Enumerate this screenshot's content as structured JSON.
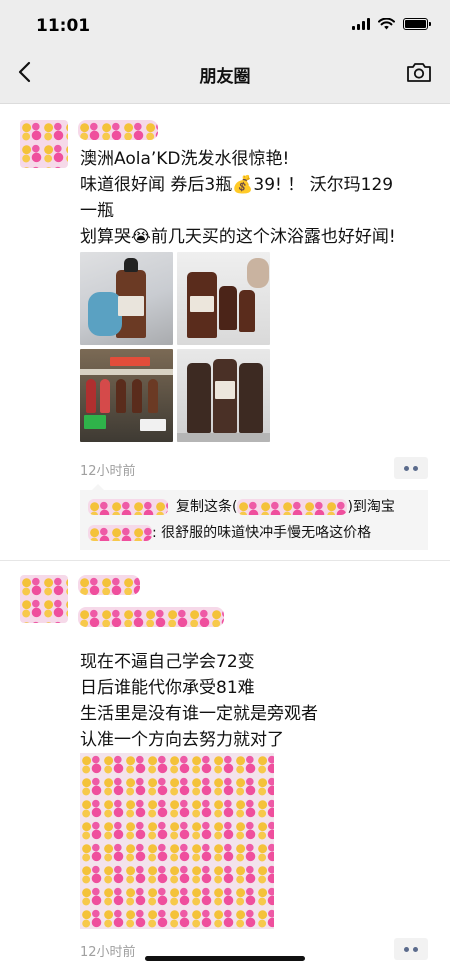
{
  "status_bar": {
    "time": "11:01"
  },
  "nav": {
    "title": "朋友圈"
  },
  "posts": [
    {
      "text": [
        "澳洲Aola’KD洗发水很惊艳!",
        "味道很好闻 券后3瓶💰39!  ！ 沃尔玛129",
        "一瓶",
        "划算哭😭前几天买的这个沐浴露也好好闻!"
      ],
      "photos": [
        "shampoo-hand-photo",
        "bottles-counter-photo",
        "store-shelf-photo",
        "bottles-display-photo"
      ],
      "timestamp": "12小时前",
      "comments": [
        {
          "pre": "复制这条(",
          "post": ")到淘宝"
        },
        {
          "pre": ": 很舒服的味道快冲手慢无咯这价格",
          "post": ""
        }
      ]
    },
    {
      "text": [
        "现在不逼自己学会72变",
        "日后谁能代你承受81难",
        "生活里是没有谁一定就是旁观者",
        "认准一个方向去努力就对了"
      ],
      "timestamp": "12小时前"
    }
  ]
}
